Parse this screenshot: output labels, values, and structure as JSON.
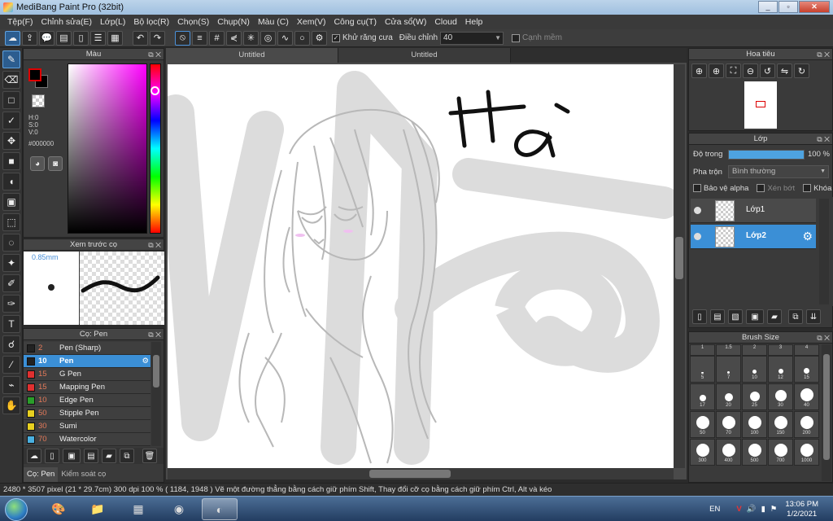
{
  "window": {
    "title": "MediBang Paint Pro (32bit)",
    "minimize": "_",
    "maximize": "▫",
    "close": "✕"
  },
  "menu": [
    "Tệp(F)",
    "Chỉnh sửa(E)",
    "Lớp(L)",
    "Bộ lọc(R)",
    "Chọn(S)",
    "Chụp(N)",
    "Màu (C)",
    "Xem(V)",
    "Công cụ(T)",
    "Cửa sổ(W)",
    "Cloud",
    "Help"
  ],
  "toolbar": {
    "antialias_label": "Khử răng cưa",
    "antialias_checked": true,
    "correction_label": "Điều chỉnh",
    "correction_value": "40",
    "soft_edge_label": "Cạnh mềm",
    "soft_edge_checked": false
  },
  "tabs": [
    "Untitled",
    "Untitled"
  ],
  "color_panel": {
    "title": "Màu",
    "h": "H:0",
    "s": "S:0",
    "v": "V:0",
    "hex": "#000000"
  },
  "brush_preview": {
    "title": "Xem trước cọ",
    "size": "0.85mm"
  },
  "brush_panel": {
    "title": "Cọ: Pen",
    "brushes": [
      {
        "size": "2",
        "name": "Pen (Sharp)",
        "color": "#222222"
      },
      {
        "size": "10",
        "name": "Pen",
        "color": "#222222"
      },
      {
        "size": "15",
        "name": "G Pen",
        "color": "#e03030"
      },
      {
        "size": "15",
        "name": "Mapping Pen",
        "color": "#e03030"
      },
      {
        "size": "10",
        "name": "Edge Pen",
        "color": "#2a9d2a"
      },
      {
        "size": "50",
        "name": "Stipple Pen",
        "color": "#e8d020"
      },
      {
        "size": "30",
        "name": "Sumi",
        "color": "#e8d020"
      },
      {
        "size": "70",
        "name": "Watercolor",
        "color": "#4ab0e0"
      }
    ],
    "tab_brush": "Cọ: Pen",
    "tab_control": "Kiểm soát cọ"
  },
  "navigator": {
    "title": "Hoa tiêu"
  },
  "layer_panel": {
    "title": "Lớp",
    "opacity_label": "Độ trong",
    "opacity_value": "100 %",
    "opacity_fraction": 1.0,
    "blend_label": "Pha trộn",
    "blend_value": "Bình thường",
    "protect_alpha": "Bảo vệ alpha",
    "clipping": "Xén bớt",
    "lock": "Khóa",
    "layers": [
      {
        "name": "Lớp1"
      },
      {
        "name": "Lớp2"
      }
    ]
  },
  "brush_size": {
    "title": "Brush Size",
    "sizes": [
      "1",
      "1.5",
      "2",
      "3",
      "4",
      "5",
      "7",
      "10",
      "12",
      "15",
      "17",
      "20",
      "25",
      "30",
      "40",
      "50",
      "70",
      "100",
      "150",
      "200",
      "300",
      "400",
      "500",
      "700",
      "1000"
    ]
  },
  "canvas": {
    "text": "Hà"
  },
  "status": {
    "text": "2480 * 3507 pixel   (21 * 29.7cm)   300 dpi   100 %   ( 1184, 1948 )   Vẽ một đường thẳng bằng cách giữ phím Shift, Thay đổi cỡ cọ bằng cách giữ phím Ctrl, Alt và kéo"
  },
  "tray": {
    "lang": "EN",
    "time": "13:06 PM",
    "date": "1/2/2021"
  }
}
